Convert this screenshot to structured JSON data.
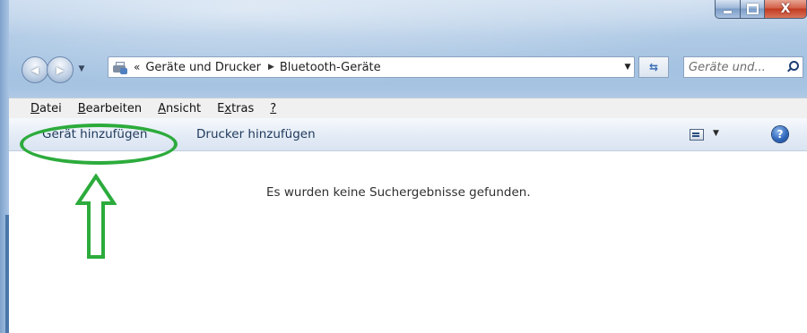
{
  "titlebar": {
    "minimize_glyph": "",
    "maximize_glyph": "",
    "close_glyph": "X"
  },
  "navigation": {
    "back_glyph": "◀",
    "forward_glyph": "▶",
    "dropdown_glyph": "▼"
  },
  "address_bar": {
    "icon": "devices-printers-icon",
    "overflow": "«",
    "breadcrumbs": [
      "Geräte und Drucker",
      "Bluetooth-Geräte"
    ],
    "separator": "▶",
    "dropdown_glyph": "▼",
    "refresh_glyph": "⇆"
  },
  "search": {
    "placeholder": "Geräte und...",
    "icon": "search-icon"
  },
  "menu": {
    "items": [
      {
        "accel": "D",
        "rest": "atei"
      },
      {
        "accel": "B",
        "rest": "earbeiten"
      },
      {
        "accel": "A",
        "rest": "nsicht"
      },
      {
        "prefix": "E",
        "accel": "x",
        "rest": "tras"
      },
      {
        "accel": "?",
        "rest": ""
      }
    ]
  },
  "commandbar": {
    "add_device": "Gerät hinzufügen",
    "add_printer": "Drucker hinzufügen",
    "view_dropdown_glyph": "▼",
    "help_glyph": "?"
  },
  "content": {
    "empty_message": "Es wurden keine Suchergebnisse gefunden."
  },
  "annotation": {
    "color": "#2cab3c"
  }
}
